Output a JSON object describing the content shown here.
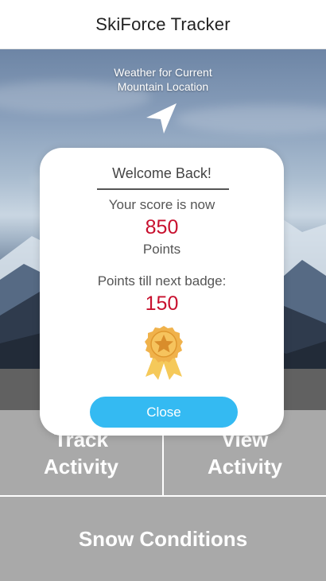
{
  "app": {
    "title": "SkiForce Tracker"
  },
  "hero": {
    "weather_line1": "Weather for Current",
    "weather_line2": "Mountain Location",
    "icon": "navigation-arrow-icon"
  },
  "tiles": {
    "track_line1": "Track",
    "track_line2": "Activity",
    "view_line1": "View",
    "view_line2": "Activity",
    "snow": "Snow Conditions"
  },
  "modal": {
    "welcome": "Welcome Back!",
    "score_intro": "Your score is now",
    "score": "850",
    "points_word": "Points",
    "next_intro": "Points till next badge:",
    "next_value": "150",
    "badge_icon": "award-badge-icon",
    "close_label": "Close"
  },
  "colors": {
    "accent": "#34baf2",
    "value_red": "#c8102e",
    "tile_gray": "#a9a9a9",
    "strip_gray": "#616161",
    "badge_gold": "#f0b24b"
  }
}
